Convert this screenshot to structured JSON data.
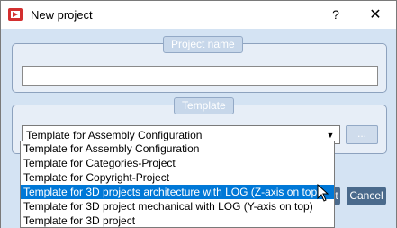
{
  "window": {
    "title": "New project",
    "help_glyph": "?",
    "close_glyph": "✕"
  },
  "project_name": {
    "legend": "Project name",
    "value": ""
  },
  "template": {
    "legend": "Template",
    "selected": "Template for Assembly Configuration",
    "browse_label": "...",
    "options": [
      "Template for Assembly Configuration",
      "Template for Categories-Project",
      "Template for Copyright-Project",
      "Template for 3D projects architecture with LOG (Z-axis on top)",
      "Template for 3D project mechanical with LOG (Y-axis on top)",
      "Template for 3D project"
    ],
    "highlighted_index": 3
  },
  "footer": {
    "ok_label_partial": "t",
    "cancel_label": "Cancel"
  },
  "colors": {
    "panel": "#d4e3f3",
    "legend": "#c7d7ea",
    "button": "#4a6a8c",
    "highlight": "#0078d7"
  }
}
